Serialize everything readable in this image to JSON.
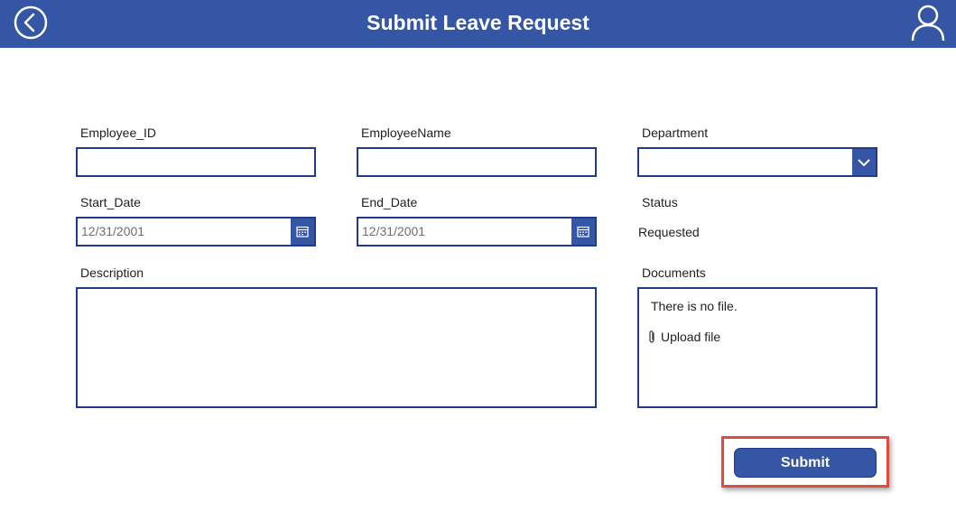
{
  "header": {
    "title": "Submit Leave Request",
    "back_icon": "chevron-left-circle-icon",
    "user_icon": "user-icon",
    "color": "#3556a4"
  },
  "form": {
    "employee_id": {
      "label": "Employee_ID",
      "value": ""
    },
    "employee_name": {
      "label": "EmployeeName",
      "value": ""
    },
    "department": {
      "label": "Department",
      "selected": ""
    },
    "start_date": {
      "label": "Start_Date",
      "value": "12/31/2001"
    },
    "end_date": {
      "label": "End_Date",
      "value": "12/31/2001"
    },
    "status": {
      "label": "Status",
      "value": "Requested"
    },
    "description": {
      "label": "Description",
      "value": ""
    },
    "documents": {
      "label": "Documents",
      "empty_text": "There is no file.",
      "upload_label": "Upload file"
    }
  },
  "actions": {
    "submit_label": "Submit"
  },
  "colors": {
    "accent": "#3556a4",
    "border": "#223a8c",
    "highlight": "#e04b3c"
  }
}
